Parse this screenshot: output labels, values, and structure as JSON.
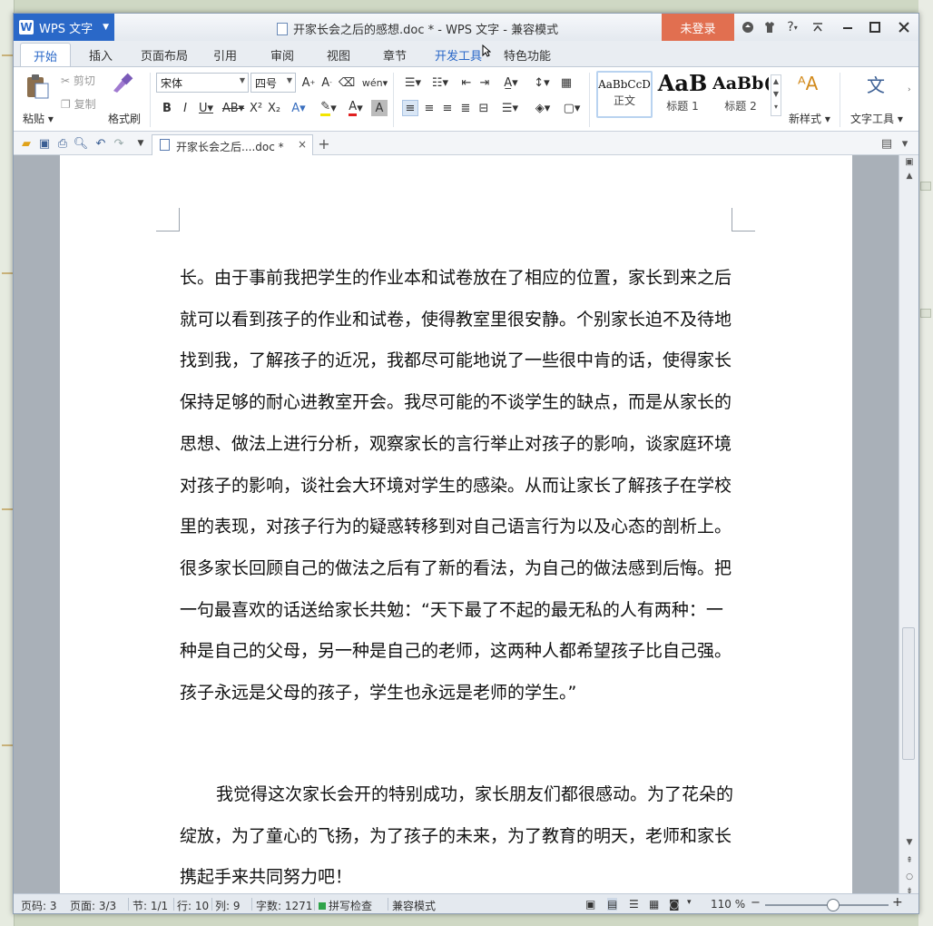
{
  "app": {
    "name": "WPS 文字",
    "window_title": "开家长会之后的感想.doc * - WPS 文字 - 兼容模式",
    "login_label": "未登录",
    "help_label": "?"
  },
  "tabs": [
    "开始",
    "插入",
    "页面布局",
    "引用",
    "审阅",
    "视图",
    "章节",
    "开发工具",
    "特色功能"
  ],
  "ribbon": {
    "paste": "粘贴",
    "cut": "剪切",
    "copy": "复制",
    "format_painter": "格式刷",
    "font_name": "宋体",
    "font_size": "四号",
    "styles": [
      {
        "sample": "AaBbCcD",
        "name": "正文"
      },
      {
        "sample": "AaB",
        "name": "标题 1"
      },
      {
        "sample": "AaBb(",
        "name": "标题 2"
      }
    ],
    "new_style": "新样式",
    "text_tools": "文字工具"
  },
  "doc_tab": {
    "title": "开家长会之后....doc *",
    "close": "×",
    "add": "+"
  },
  "document": {
    "para1": "长。由于事前我把学生的作业本和试卷放在了相应的位置，家长到来之后就可以看到孩子的作业和试卷，使得教室里很安静。个别家长迫不及待地找到我，了解孩子的近况，我都尽可能地说了一些很中肯的话，使得家长保持足够的耐心进教室开会。我尽可能的不谈学生的缺点，而是从家长的思想、做法上进行分析，观察家长的言行举止对孩子的影响，谈家庭环境对孩子的影响，谈社会大环境对学生的感染。从而让家长了解孩子在学校里的表现，对孩子行为的疑惑转移到对自己语言行为以及心态的剖析上。很多家长回顾自己的做法之后有了新的看法，为自己的做法感到后悔。把一句最喜欢的话送给家长共勉：“天下最了不起的最无私的人有两种：一种是自己的父母，另一种是自己的老师，这两种人都希望孩子比自己强。孩子永远是父母的孩子，学生也永远是老师的学生。”",
    "para2": "我觉得这次家长会开的特别成功，家长朋友们都很感动。为了花朵的绽放，为了童心的飞扬，为了孩子的未来，为了教育的明天，老师和家长携起手来共同努力吧！"
  },
  "status": {
    "page_no": "页码: 3",
    "pages": "页面: 3/3",
    "section": "节: 1/1",
    "row": "行: 10",
    "col": "列: 9",
    "word_count": "字数: 1271",
    "spell_check": "拼写检查",
    "compat_mode": "兼容模式",
    "zoom": "110 %",
    "zoom_level": 0.55
  },
  "colors": {
    "accent": "#2a68c8",
    "login": "#e16f50"
  }
}
